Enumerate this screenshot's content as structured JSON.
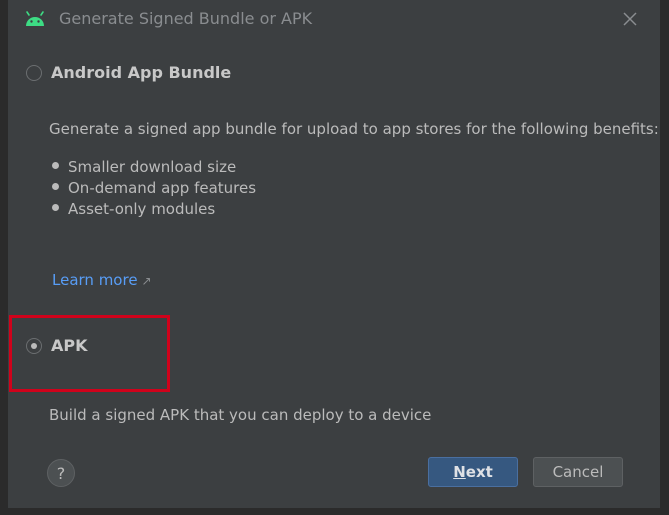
{
  "window": {
    "title": "Generate Signed Bundle or APK",
    "icon": "android-icon",
    "close_icon": "close-icon"
  },
  "options": {
    "bundle": {
      "label": "Android App Bundle",
      "selected": false,
      "description": "Generate a signed app bundle for upload to app stores for the following benefits:",
      "benefits": [
        "Smaller download size",
        "On-demand app features",
        "Asset-only modules"
      ],
      "learn_more": "Learn more",
      "learn_more_icon": "external-link-arrow-icon"
    },
    "apk": {
      "label": "APK",
      "selected": true,
      "description": "Build a signed APK that you can deploy to a device"
    }
  },
  "footer": {
    "help_label": "?",
    "next_label": "Next",
    "cancel_label": "Cancel"
  },
  "colors": {
    "background": "#3c3f41",
    "link": "#589df6",
    "primary_button": "#365880",
    "highlight": "#d0021b",
    "android_green": "#3ddc84"
  }
}
